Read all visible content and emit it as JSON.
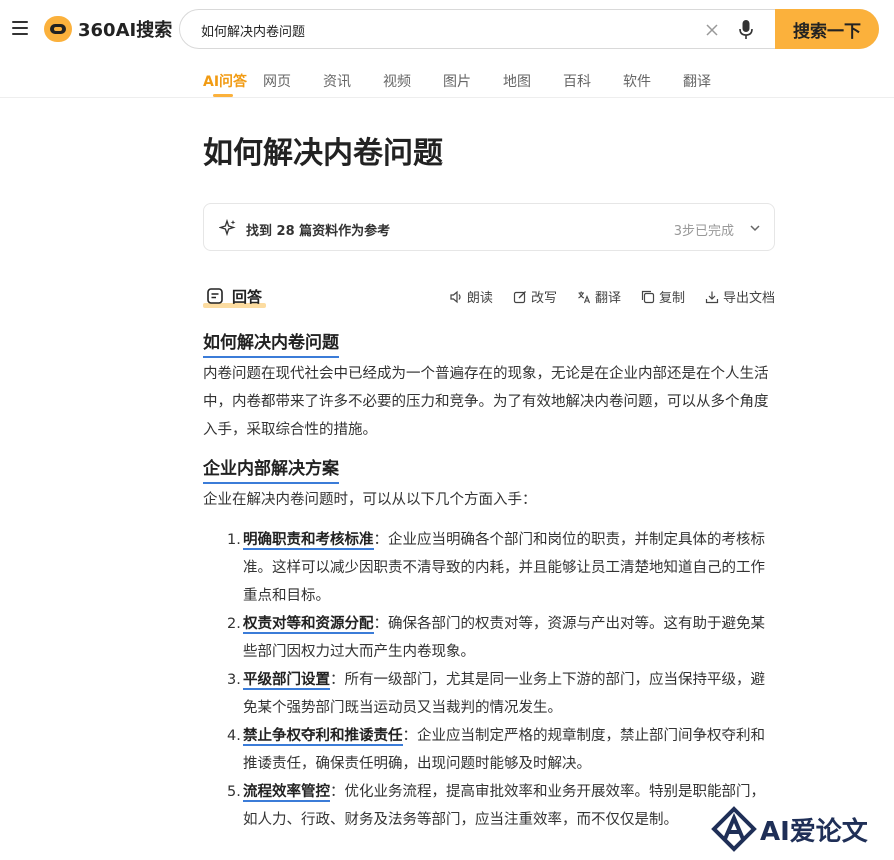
{
  "header": {
    "logo_text": "360AI搜索",
    "search_value": "如何解决内卷问题",
    "search_button": "搜索一下"
  },
  "tabs": [
    {
      "label": "AI问答",
      "active": true
    },
    {
      "label": "网页"
    },
    {
      "label": "资讯"
    },
    {
      "label": "视频"
    },
    {
      "label": "图片"
    },
    {
      "label": "地图"
    },
    {
      "label": "百科"
    },
    {
      "label": "软件"
    },
    {
      "label": "翻译"
    }
  ],
  "page_title": "如何解决内卷问题",
  "reference": {
    "text": "找到 28 篇资料作为参考",
    "status": "3步已完成"
  },
  "answer": {
    "label": "回答",
    "actions": [
      "朗读",
      "改写",
      "翻译",
      "复制",
      "导出文档"
    ]
  },
  "content": {
    "section1_title": "如何解决内卷问题",
    "section1_text": "内卷问题在现代社会中已经成为一个普遍存在的现象，无论是在企业内部还是在个人生活中，内卷都带来了许多不必要的压力和竞争。为了有效地解决内卷问题，可以从多个角度入手，采取综合性的措施。",
    "section2_title": "企业内部解决方案",
    "section2_text": "企业在解决内卷问题时，可以从以下几个方面入手：",
    "items": [
      {
        "num": "1.",
        "title": "明确职责和考核标准",
        "text": "：企业应当明确各个部门和岗位的职责，并制定具体的考核标准。这样可以减少因职责不清导致的内耗，并且能够让员工清楚地知道自己的工作重点和目标。"
      },
      {
        "num": "2.",
        "title": "权责对等和资源分配",
        "text": "：确保各部门的权责对等，资源与产出对等。这有助于避免某些部门因权力过大而产生内卷现象。"
      },
      {
        "num": "3.",
        "title": "平级部门设置",
        "text": "：所有一级部门，尤其是同一业务上下游的部门，应当保持平级，避免某个强势部门既当运动员又当裁判的情况发生。"
      },
      {
        "num": "4.",
        "title": "禁止争权夺利和推诿责任",
        "text": "：企业应当制定严格的规章制度，禁止部门间争权夺利和推诿责任，确保责任明确，出现问题时能够及时解决。"
      },
      {
        "num": "5.",
        "title": "流程效率管控",
        "text": "：优化业务流程，提高审批效率和业务开展效率。特别是职能部门，如人力、行政、财务及法务等部门，应当注重效率，而不仅仅是制。"
      }
    ]
  },
  "watermark": {
    "text": "AI爱论文"
  }
}
